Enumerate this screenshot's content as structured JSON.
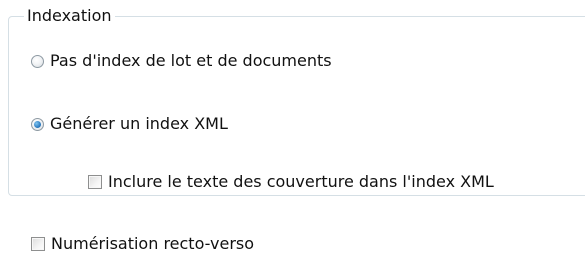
{
  "indexation": {
    "title": "Indexation",
    "options": [
      {
        "label": "Pas d'index de lot et de documents",
        "selected": false
      },
      {
        "label": "Générer un index XML",
        "selected": true
      }
    ],
    "include_cover_text": {
      "label": "Inclure le texte des couverture dans l'index XML",
      "checked": false
    }
  },
  "duplex_scan": {
    "label": "Numérisation recto-verso",
    "checked": false
  }
}
